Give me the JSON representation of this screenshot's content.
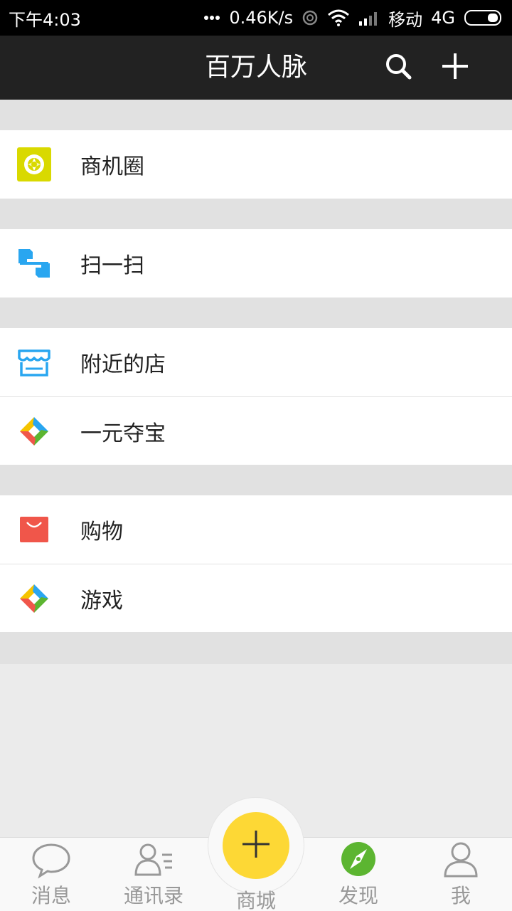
{
  "status": {
    "time": "下午4:03",
    "speed": "0.46K/s",
    "carrier": "移动",
    "network": "4G"
  },
  "header": {
    "title": "百万人脉",
    "search_icon": "search-icon",
    "add_icon": "plus-icon"
  },
  "menu": [
    {
      "label": "商机圈",
      "icon": "aperture-icon",
      "color": "#d9d900"
    },
    {
      "label": "扫一扫",
      "icon": "scan-icon",
      "color": "#29a6f0"
    },
    {
      "label": "附近的店",
      "icon": "shop-icon",
      "color": "#29a6f0"
    },
    {
      "label": "一元夺宝",
      "icon": "pinwheel-icon",
      "color": "#f5c400"
    },
    {
      "label": "购物",
      "icon": "shopping-bag-icon",
      "color": "#f0564a"
    },
    {
      "label": "游戏",
      "icon": "pinwheel-icon",
      "color": "#f5c400"
    }
  ],
  "tabs": [
    {
      "label": "消息",
      "icon": "chat-bubble-icon"
    },
    {
      "label": "通讯录",
      "icon": "contacts-icon"
    },
    {
      "label": "商城",
      "icon": "plus-icon"
    },
    {
      "label": "发现",
      "icon": "compass-icon",
      "active": true
    },
    {
      "label": "我",
      "icon": "person-icon"
    }
  ],
  "colors": {
    "accent_green": "#5cb531",
    "center_yellow": "#fdd835",
    "header_bg": "#222222"
  }
}
